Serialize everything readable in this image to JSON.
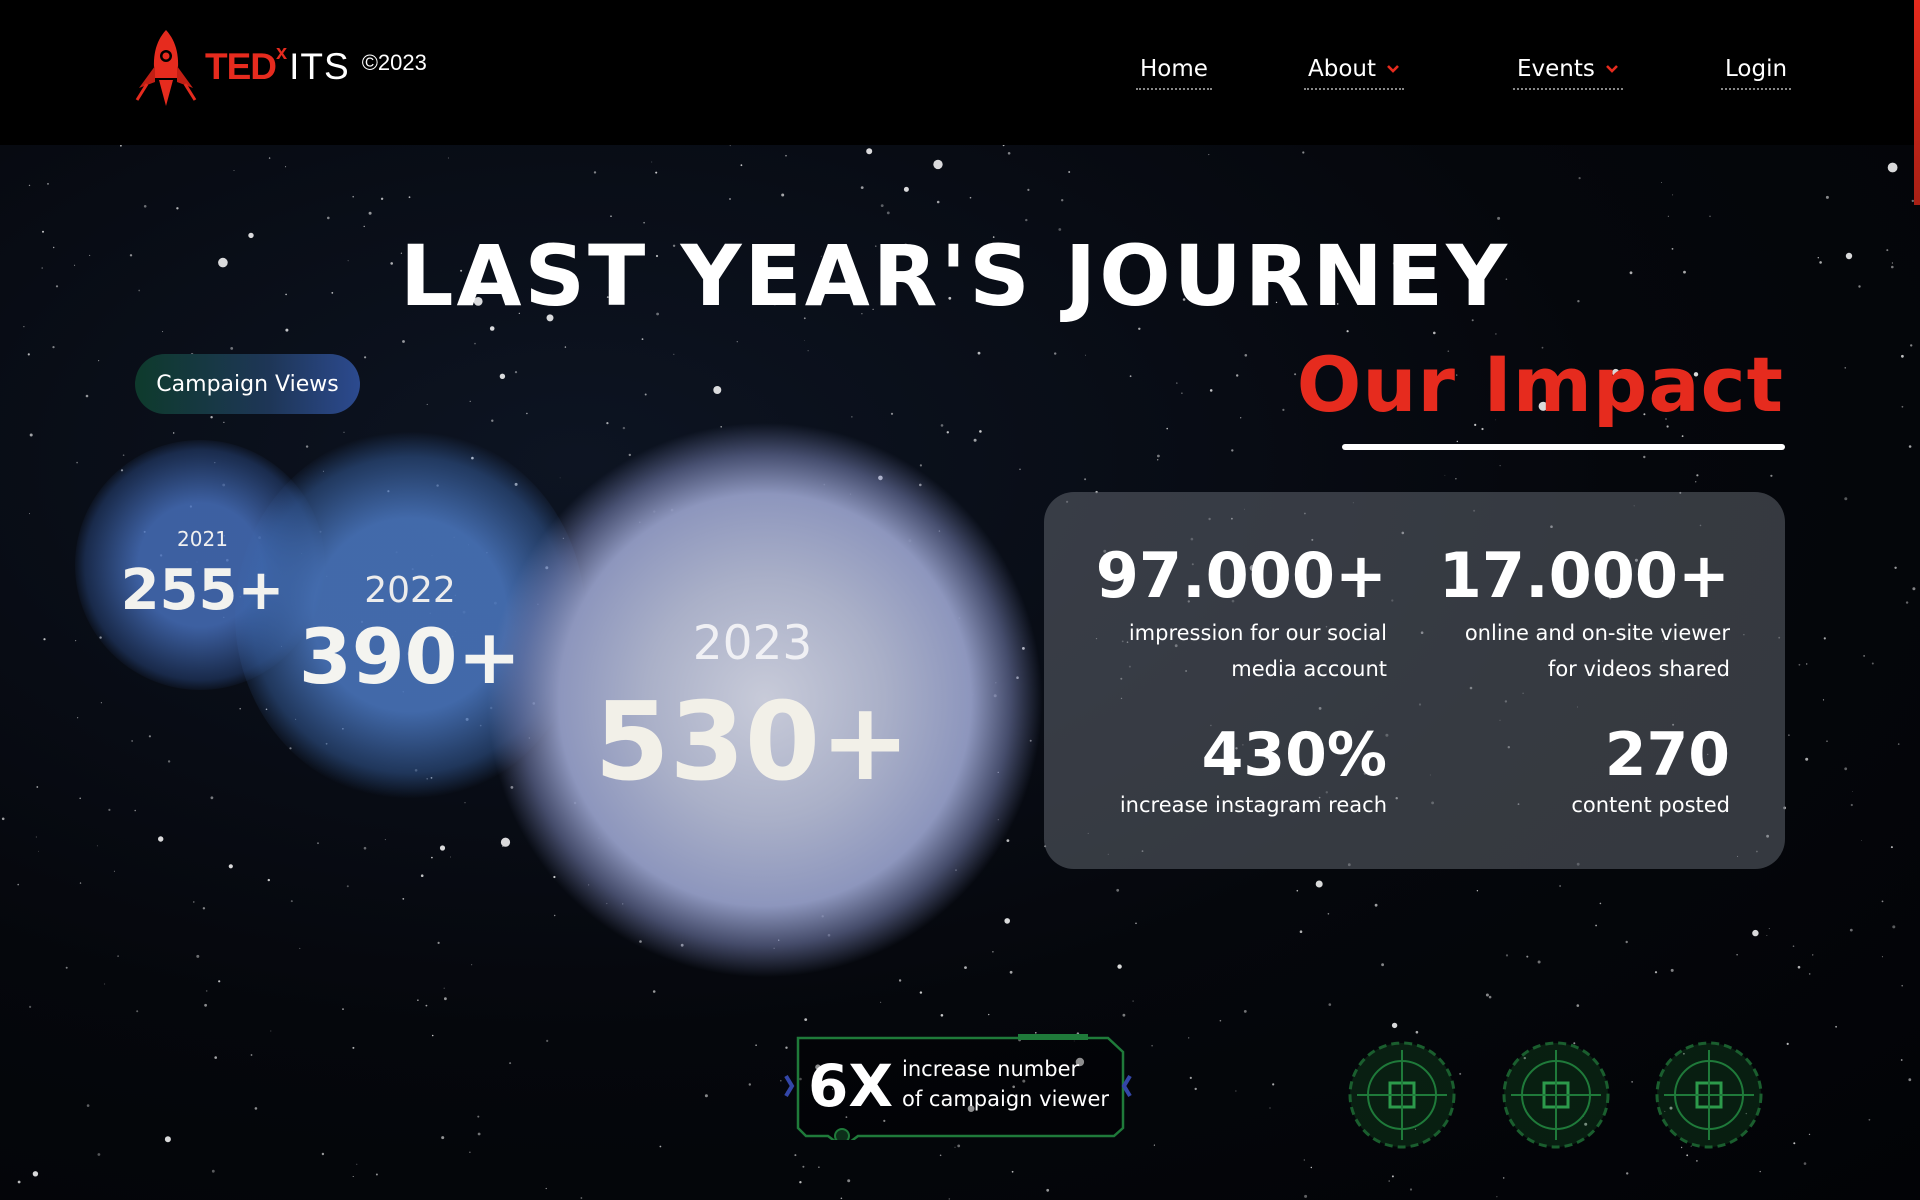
{
  "nav": {
    "brand_ted": "TED",
    "brand_x": "x",
    "brand_its": "ITS",
    "brand_year": "©2023",
    "items": [
      {
        "label": "Home"
      },
      {
        "label": "About"
      },
      {
        "label": "Events"
      },
      {
        "label": "Login"
      }
    ]
  },
  "headline": "LAST YEAR'S JOURNEY",
  "campaign": {
    "pill_label": "Campaign Views",
    "stats": [
      {
        "year": "2021",
        "value": "255+"
      },
      {
        "year": "2022",
        "value": "390+"
      },
      {
        "year": "2023",
        "value": "530+"
      }
    ]
  },
  "impact": {
    "title": "Our Impact",
    "metrics": [
      {
        "value": "97.000+",
        "label_line1": "impression for our social",
        "label_line2": "media account"
      },
      {
        "value": "17.000+",
        "label_line1": "online and on-site viewer",
        "label_line2": "for videos shared"
      },
      {
        "value": "430%",
        "label_line1": "increase instagram reach"
      },
      {
        "value": "270",
        "label_line1": "content posted"
      }
    ]
  },
  "growth": {
    "value": "6X",
    "line1": "increase number",
    "line2": "of campaign viewer"
  },
  "colors": {
    "accent_red": "#e62b1e",
    "hud_green": "#1f7a3a",
    "background": "#000000"
  }
}
